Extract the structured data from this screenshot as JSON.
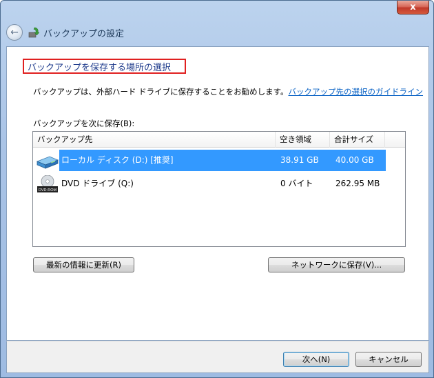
{
  "window": {
    "title": "バックアップの設定",
    "close_glyph": "x"
  },
  "main": {
    "heading": "バックアップを保存する場所の選択",
    "description": "バックアップは、外部ハード ドライブに保存することをお勧めします。",
    "guideline_link": "バックアップ先の選択のガイドライン",
    "list_label": "バックアップを次に保存(B):",
    "columns": [
      "バックアップ先",
      "空き領域",
      "合計サイズ"
    ],
    "rows": [
      {
        "name": "ローカル ディスク (D:) [推奨]",
        "free": "38.91 GB",
        "total": "40.00 GB",
        "icon": "hard-drive-icon",
        "selected": true
      },
      {
        "name": "DVD ドライブ (Q:)",
        "free": "0 バイト",
        "total": "262.95 MB",
        "icon": "dvd-drive-icon",
        "selected": false,
        "icon_label": "DVD-ROM"
      }
    ],
    "refresh_button": "最新の情報に更新(R)",
    "network_button": "ネットワークに保存(V)..."
  },
  "footer": {
    "next_button": "次へ(N)",
    "cancel_button": "キャンセル"
  },
  "colors": {
    "selection": "#3399ff",
    "heading_border": "#e02020",
    "link": "#0b63c5"
  }
}
